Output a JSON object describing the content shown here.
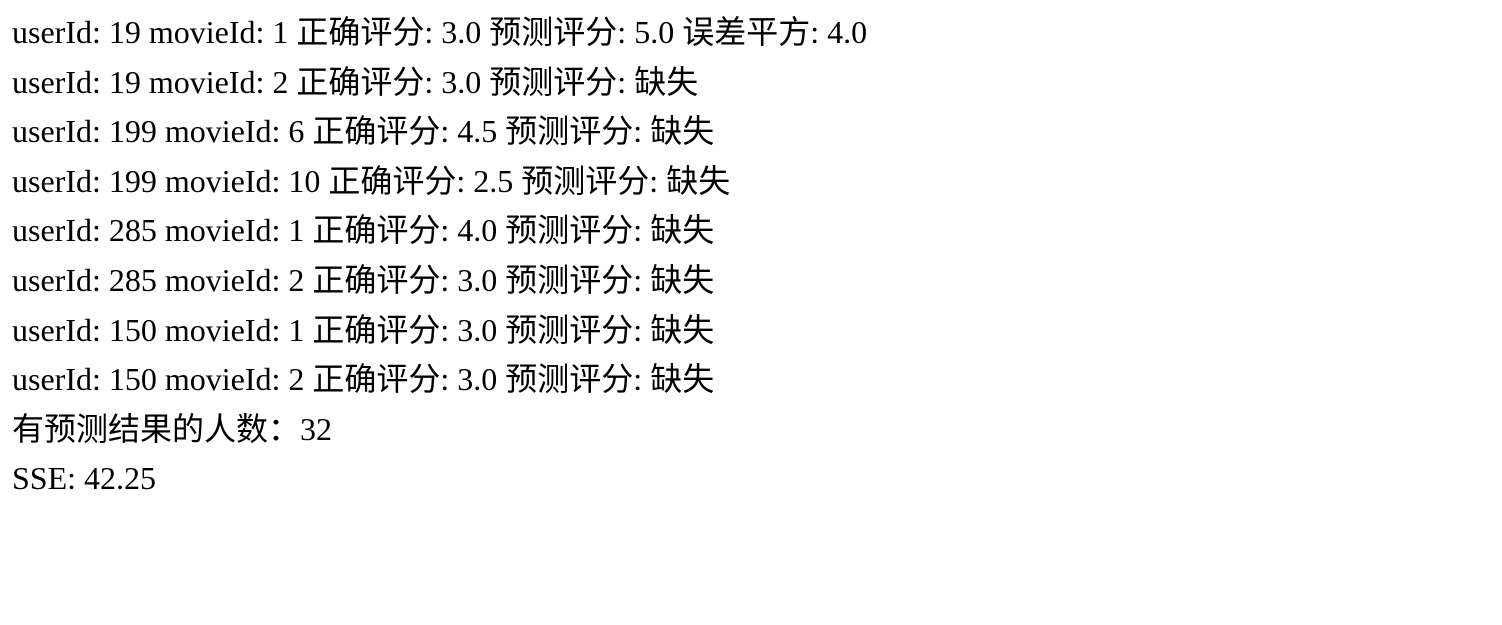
{
  "labels": {
    "userId": "userId: ",
    "movieId": " movieId: ",
    "correctRating": " 正确评分: ",
    "predictedRating": " 预测评分: ",
    "squaredError": " 误差平方: ",
    "predictedCountLabel": "有预测结果的人数：",
    "sseLabel": "SSE: "
  },
  "rows": [
    {
      "userId": "19",
      "movieId": "1",
      "correct": "3.0",
      "predicted": "5.0",
      "sqerr": "4.0"
    },
    {
      "userId": "19",
      "movieId": "2",
      "correct": "3.0",
      "predicted": "缺失",
      "sqerr": null
    },
    {
      "userId": "199",
      "movieId": "6",
      "correct": "4.5",
      "predicted": "缺失",
      "sqerr": null
    },
    {
      "userId": "199",
      "movieId": "10",
      "correct": "2.5",
      "predicted": "缺失",
      "sqerr": null
    },
    {
      "userId": "285",
      "movieId": "1",
      "correct": "4.0",
      "predicted": "缺失",
      "sqerr": null
    },
    {
      "userId": "285",
      "movieId": "2",
      "correct": "3.0",
      "predicted": "缺失",
      "sqerr": null
    },
    {
      "userId": "150",
      "movieId": "1",
      "correct": "3.0",
      "predicted": "缺失",
      "sqerr": null
    },
    {
      "userId": "150",
      "movieId": "2",
      "correct": "3.0",
      "predicted": "缺失",
      "sqerr": null
    }
  ],
  "summary": {
    "predictedCount": "32",
    "sse": "42.25"
  }
}
